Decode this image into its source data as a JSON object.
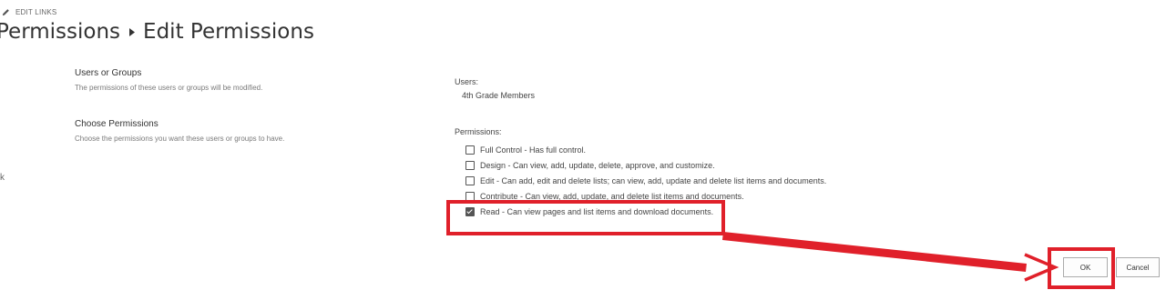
{
  "header": {
    "edit_links_label": "EDIT LINKS",
    "breadcrumb_parent": "Permissions",
    "breadcrumb_current": "Edit Permissions"
  },
  "left_stub_text": "k",
  "sections": {
    "users_or_groups": {
      "title": "Users or Groups",
      "description": "The permissions of these users or groups will be modified."
    },
    "choose_permissions": {
      "title": "Choose Permissions",
      "description": "Choose the permissions you want these users or groups to have."
    }
  },
  "users": {
    "label": "Users:",
    "value": "4th Grade Members"
  },
  "permissions": {
    "label": "Permissions:",
    "options": [
      {
        "label": "Full Control - Has full control.",
        "checked": false
      },
      {
        "label": "Design - Can view, add, update, delete, approve, and customize.",
        "checked": false
      },
      {
        "label": "Edit - Can add, edit and delete lists; can view, add, update and delete list items and documents.",
        "checked": false
      },
      {
        "label": "Contribute - Can view, add, update, and delete list items and documents.",
        "checked": false
      },
      {
        "label": "Read - Can view pages and list items and download documents.",
        "checked": true
      }
    ]
  },
  "buttons": {
    "ok_label": "OK",
    "cancel_label": "Cancel"
  },
  "annotation": {
    "color": "#e0202a"
  },
  "icons": {
    "edit_links": "pencil-icon",
    "breadcrumb_separator": "caret-right-icon"
  }
}
